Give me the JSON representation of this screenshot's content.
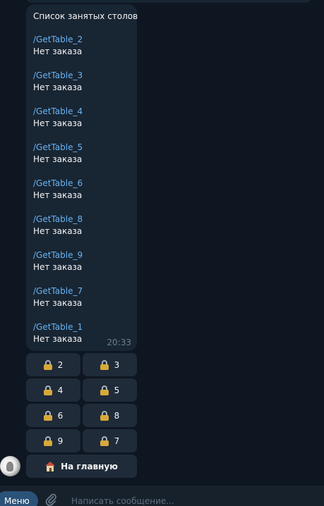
{
  "message": {
    "title": "Список занятых столов",
    "time": "20:33",
    "entries": [
      {
        "command": "/GetTable_2",
        "status": "Нет заказа"
      },
      {
        "command": "/GetTable_3",
        "status": "Нет заказа"
      },
      {
        "command": "/GetTable_4",
        "status": "Нет заказа"
      },
      {
        "command": "/GetTable_5",
        "status": "Нет заказа"
      },
      {
        "command": "/GetTable_6",
        "status": "Нет заказа"
      },
      {
        "command": "/GetTable_8",
        "status": "Нет заказа"
      },
      {
        "command": "/GetTable_9",
        "status": "Нет заказа"
      },
      {
        "command": "/GetTable_7",
        "status": "Нет заказа"
      },
      {
        "command": "/GetTable_1",
        "status": "Нет заказа"
      }
    ]
  },
  "keyboard": {
    "buttons": [
      {
        "label": "2",
        "icon": "lock-icon"
      },
      {
        "label": "3",
        "icon": "lock-icon"
      },
      {
        "label": "4",
        "icon": "lock-icon"
      },
      {
        "label": "5",
        "icon": "lock-icon"
      },
      {
        "label": "6",
        "icon": "lock-icon"
      },
      {
        "label": "8",
        "icon": "lock-icon"
      },
      {
        "label": "9",
        "icon": "lock-icon"
      },
      {
        "label": "7",
        "icon": "lock-icon"
      }
    ],
    "home": {
      "label": "На главную",
      "icon": "house-icon"
    }
  },
  "composer": {
    "menu_label": "Меню",
    "placeholder": "Написать сообщение..."
  },
  "colors": {
    "background": "#0e1621",
    "bubble": "#182533",
    "link": "#6ab3f3",
    "keyboard_button": "#1f2b39",
    "menu_button": "#2b5278"
  }
}
